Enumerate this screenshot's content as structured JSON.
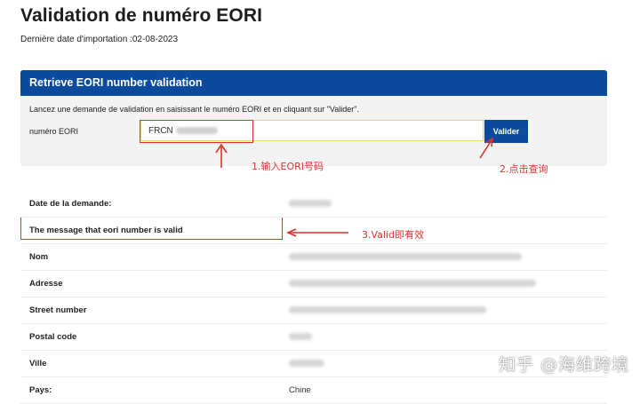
{
  "header": {
    "title": "Validation de numéro EORI",
    "import_date": "Dernière date d'importation :02-08-2023"
  },
  "form": {
    "panel_title": "Retrieve EORI number validation",
    "instruction": "Lancez une demande de validation en saisissant le numéro EORI et en cliquant sur \"Valider\".",
    "field_label": "numéro EORI",
    "input_value": "FRCN",
    "button_label": "Valider"
  },
  "annotations": {
    "step1": "1.输入EORI号码",
    "step2": "2.点击查询",
    "step3": "3.Valid即有效",
    "color": "#e0322b"
  },
  "results": {
    "rows": [
      {
        "label": "Date de la demande:",
        "value": ""
      },
      {
        "label": "The message that eori number is valid",
        "value": ""
      },
      {
        "label": "Nom",
        "value": ""
      },
      {
        "label": "Adresse",
        "value": ""
      },
      {
        "label": "Street number",
        "value": ""
      },
      {
        "label": "Postal code",
        "value": ""
      },
      {
        "label": "Ville",
        "value": ""
      },
      {
        "label": "Pays:",
        "value": "Chine"
      }
    ]
  },
  "watermark": "知乎 @海维跨境",
  "colors": {
    "brand_blue": "#0b4a9c",
    "panel_bg": "#f3f3f3",
    "input_border": "#e8d27a"
  }
}
